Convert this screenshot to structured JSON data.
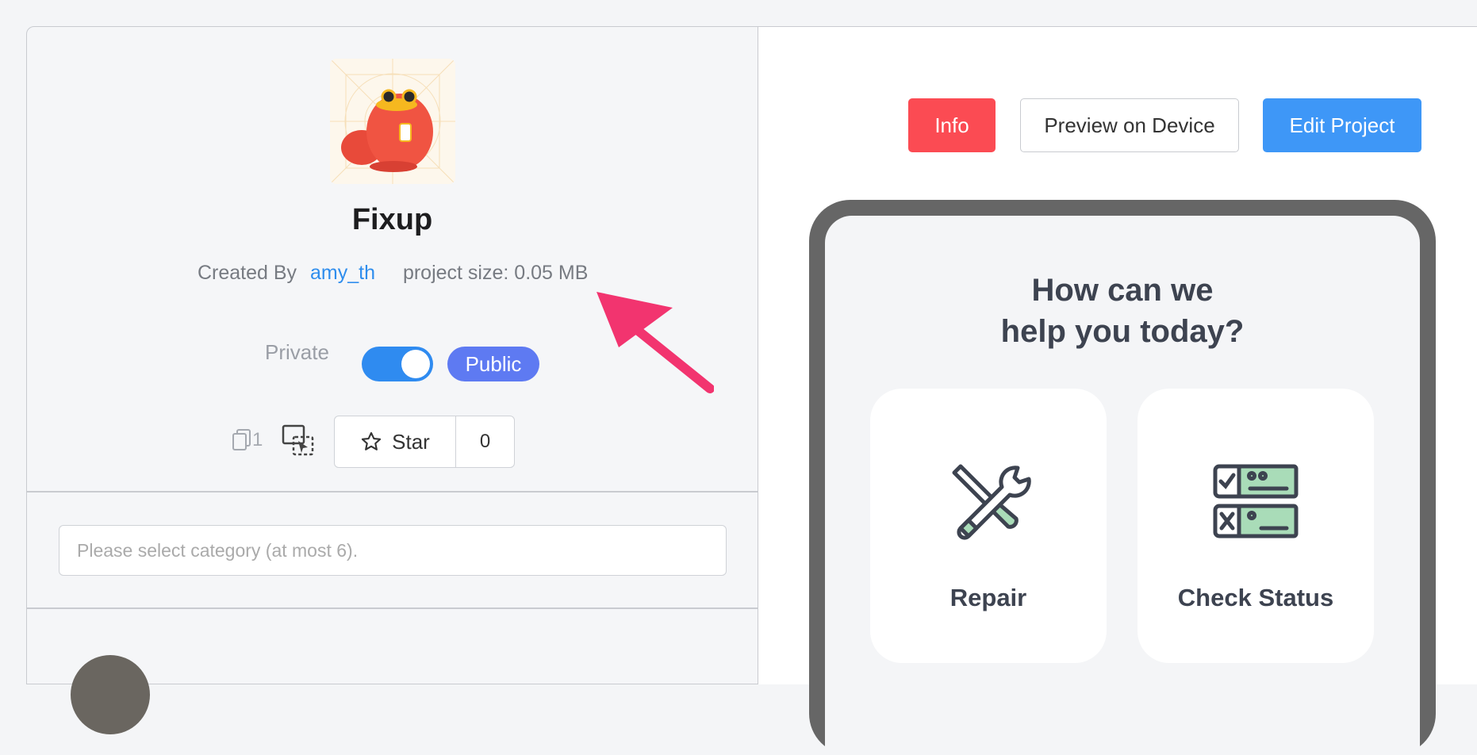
{
  "project": {
    "name": "Fixup",
    "created_by_label": "Created By",
    "author": "amy_th",
    "size_text": "project size: 0.05 MB",
    "privacy_off_label": "Private",
    "privacy_on_label": "Public",
    "is_public": true,
    "clone_count": "1",
    "star_label": "Star",
    "star_count": "0",
    "category_placeholder": "Please select category (at most 6)."
  },
  "toolbar": {
    "info_label": "Info",
    "preview_label": "Preview on Device",
    "edit_label": "Edit Project"
  },
  "preview": {
    "heading_line1": "How can we",
    "heading_line2": "help you today?",
    "cards": [
      {
        "label": "Repair",
        "icon": "tools-icon"
      },
      {
        "label": "Check Status",
        "icon": "checklist-icon"
      }
    ]
  },
  "colors": {
    "info": "#fb4b53",
    "edit": "#3e97f7",
    "toggle": "#2f8bf0",
    "public_badge": "#5e7af2",
    "annotation_arrow": "#f2346f"
  }
}
